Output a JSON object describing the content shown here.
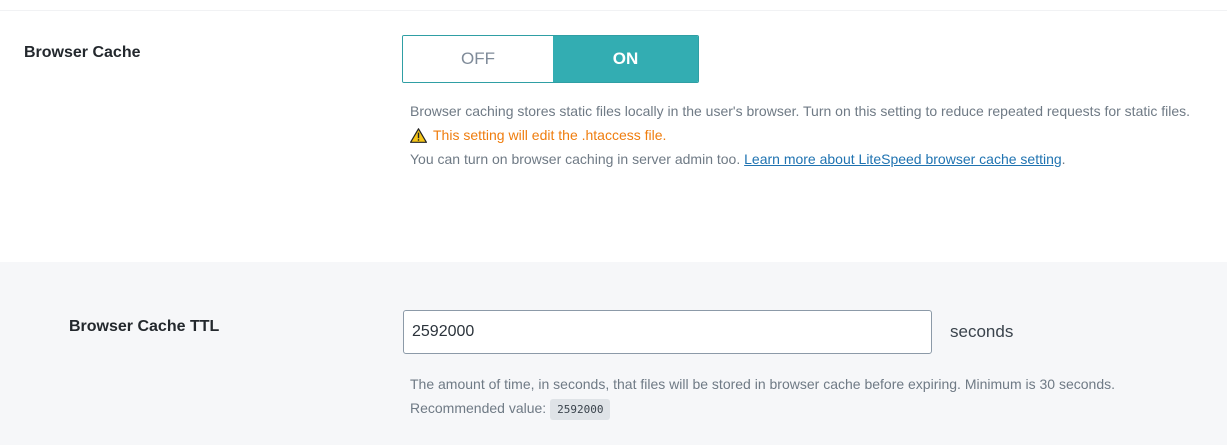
{
  "browser_cache": {
    "label": "Browser Cache",
    "toggle": {
      "off_label": "OFF",
      "on_label": "ON",
      "selected": "ON"
    },
    "description_line1": "Browser caching stores static files locally in the user's browser. Turn on this setting to reduce repeated requests for static files.",
    "warning": "This setting will edit the .htaccess file.",
    "description_line2": "You can turn on browser caching in server admin too.",
    "learn_more_link": "Learn more about LiteSpeed browser cache setting",
    "period": "."
  },
  "browser_cache_ttl": {
    "label": "Browser Cache TTL",
    "value": "2592000",
    "unit": "seconds",
    "description": "The amount of time, in seconds, that files will be stored in browser cache before expiring. Minimum is 30 seconds. Recommended value:",
    "recommended_value": "2592000"
  },
  "icons": {
    "warning": "warning-triangle-icon"
  },
  "colors": {
    "toggle_on": "#33adb2",
    "toggle_border": "#2f9fa4",
    "warning": "#ef7d0e",
    "link": "#1f73b1",
    "ttl_row_background": "#f6f7f9"
  }
}
